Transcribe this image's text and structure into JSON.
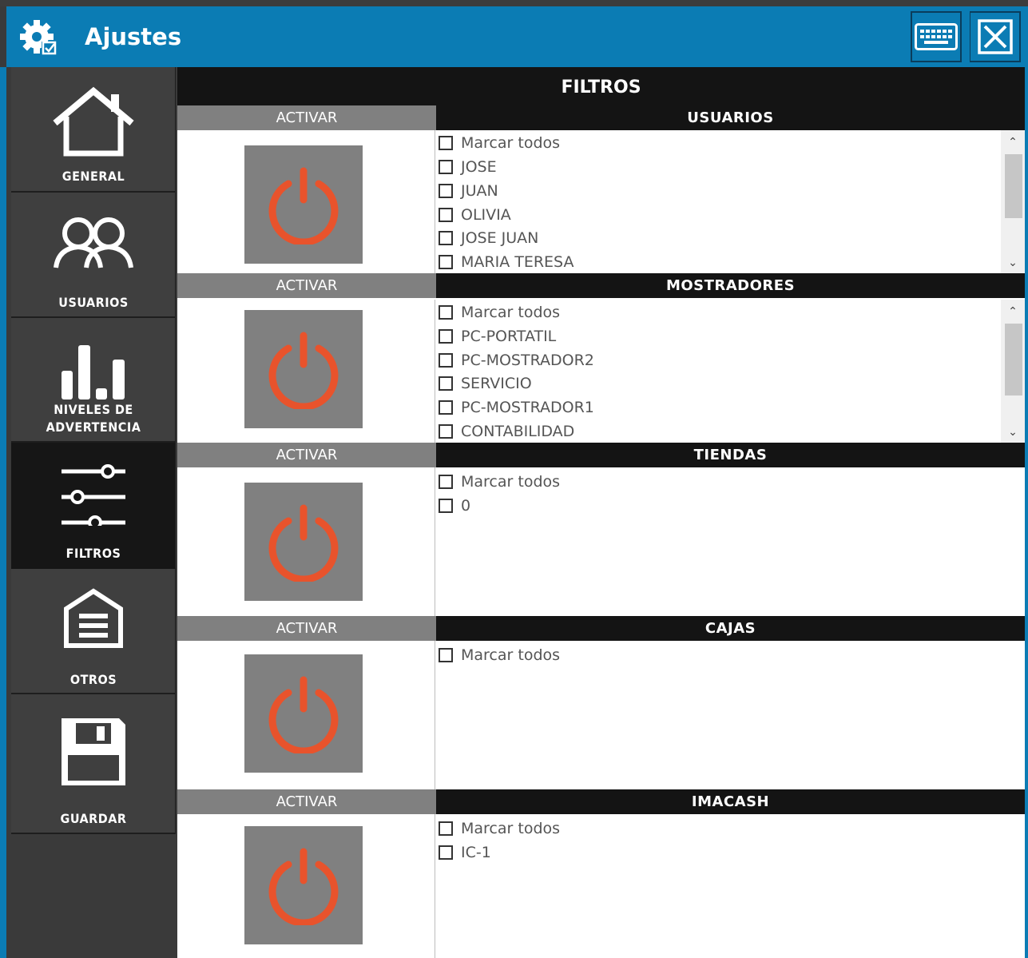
{
  "window": {
    "title": "Ajustes"
  },
  "colors": {
    "titlebar": "#0b7cb4",
    "power_icon": "#e8532c",
    "sidebar_bg": "#3f3f3f",
    "sidebar_active_bg": "#161616"
  },
  "sidebar": {
    "items": [
      {
        "label": "GENERAL",
        "icon": "house-icon",
        "active": false
      },
      {
        "label": "USUARIOS",
        "icon": "users-icon",
        "active": false
      },
      {
        "label": "NIVELES DE ADVERTENCIA",
        "icon": "bar-levels-icon",
        "active": false
      },
      {
        "label": "FILTROS",
        "icon": "sliders-icon",
        "active": true
      },
      {
        "label": "OTROS",
        "icon": "document-house-icon",
        "active": false
      },
      {
        "label": "GUARDAR",
        "icon": "floppy-save-icon",
        "active": false
      }
    ]
  },
  "main": {
    "header": "FILTROS",
    "activate_label": "ACTIVAR",
    "sections": [
      {
        "title": "USUARIOS",
        "items": [
          "Marcar todos",
          "JOSE",
          "JUAN",
          "OLIVIA",
          "JOSE JUAN",
          "MARIA TERESA"
        ]
      },
      {
        "title": "MOSTRADORES",
        "items": [
          "Marcar todos",
          "PC-PORTATIL",
          "PC-MOSTRADOR2",
          "SERVICIO",
          "PC-MOSTRADOR1",
          "CONTABILIDAD"
        ]
      },
      {
        "title": "TIENDAS",
        "items": [
          "Marcar todos",
          "0"
        ]
      },
      {
        "title": "CAJAS",
        "items": [
          "Marcar todos"
        ]
      },
      {
        "title": "IMACASH",
        "items": [
          "Marcar todos",
          "IC-1"
        ]
      }
    ]
  }
}
